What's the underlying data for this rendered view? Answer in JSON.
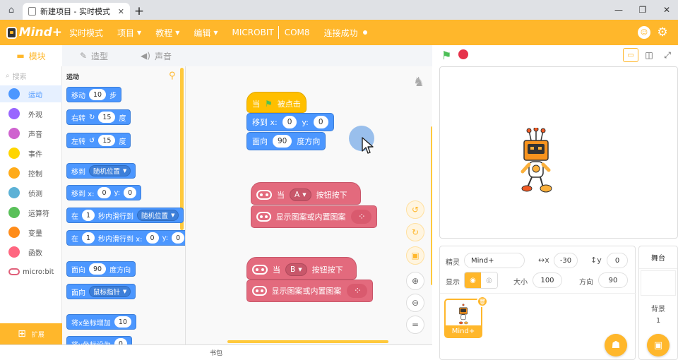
{
  "window": {
    "tab_title": "新建项目 - 实时模式"
  },
  "menubar": {
    "logo": "Mind+",
    "items": [
      {
        "label": "实时模式",
        "caret": false
      },
      {
        "label": "项目",
        "caret": true
      },
      {
        "label": "教程",
        "caret": true
      },
      {
        "label": "编辑",
        "caret": true
      }
    ],
    "board": "MICROBIT",
    "port": "COM8",
    "connection": "连接成功"
  },
  "subtabs": {
    "blocks": "模块",
    "costumes": "造型",
    "sounds": "声音"
  },
  "categories": {
    "search_placeholder": "搜索",
    "items": [
      {
        "label": "运动",
        "color": "#4c97ff"
      },
      {
        "label": "外观",
        "color": "#9966ff"
      },
      {
        "label": "声音",
        "color": "#cf63cf"
      },
      {
        "label": "事件",
        "color": "#ffd500"
      },
      {
        "label": "控制",
        "color": "#ffab19"
      },
      {
        "label": "侦测",
        "color": "#5cb1d6"
      },
      {
        "label": "运算符",
        "color": "#59c059"
      },
      {
        "label": "变量",
        "color": "#ff8c1a"
      },
      {
        "label": "函数",
        "color": "#ff6680"
      }
    ],
    "microbit": "micro:bit",
    "extend": "扩展"
  },
  "palette": {
    "title": "运动",
    "b1": {
      "a": "移动",
      "v": "10",
      "b": "步"
    },
    "b2": {
      "a": "右转",
      "v": "15",
      "b": "度"
    },
    "b3": {
      "a": "左转",
      "v": "15",
      "b": "度"
    },
    "b4": {
      "a": "移到",
      "d": "随机位置"
    },
    "b5": {
      "a": "移到 x:",
      "x": "0",
      "b": "y:",
      "y": "0"
    },
    "b6": {
      "a": "在",
      "v": "1",
      "b": "秒内滑行到",
      "d": "随机位置"
    },
    "b7": {
      "a": "在",
      "v": "1",
      "b": "秒内滑行到 x:",
      "x": "0",
      "c": "y:",
      "y": "0"
    },
    "b8": {
      "a": "面向",
      "v": "90",
      "b": "度方向"
    },
    "b9": {
      "a": "面向",
      "d": "鼠标指针"
    },
    "b10": {
      "a": "将x坐标增加",
      "v": "10"
    },
    "b11": {
      "a": "将y坐标设为",
      "v": "0"
    }
  },
  "script": {
    "hat": {
      "a": "当",
      "b": "被点击"
    },
    "goto": {
      "a": "移到 x:",
      "x": "0",
      "b": "y:",
      "y": "0"
    },
    "point": {
      "a": "面向",
      "v": "90",
      "b": "度方向"
    },
    "btnA": {
      "a": "当",
      "d": "A",
      "b": "按钮按下"
    },
    "showA": {
      "a": "显示图案或内置图案"
    },
    "btnB": {
      "a": "当",
      "d": "B",
      "b": "按钮按下"
    },
    "showB": {
      "a": "显示图案或内置图案"
    }
  },
  "backpack": "书包",
  "sprite": {
    "sprite_label": "精灵",
    "name": "Mind+",
    "x_symbol": "↔x",
    "x": "-30",
    "y_symbol": "↕y",
    "y": "0",
    "show_label": "显示",
    "size_label": "大小",
    "size": "100",
    "direction_label": "方向",
    "direction": "90",
    "thumb_name": "Mind+"
  },
  "stage_panel": {
    "title": "舞台",
    "backdrop_label": "背景",
    "backdrop_count": "1"
  },
  "colors": {
    "accent": "#ffb72b",
    "motion": "#4c97ff",
    "event": "#ffbf00",
    "microbit": "#e36a7d"
  }
}
